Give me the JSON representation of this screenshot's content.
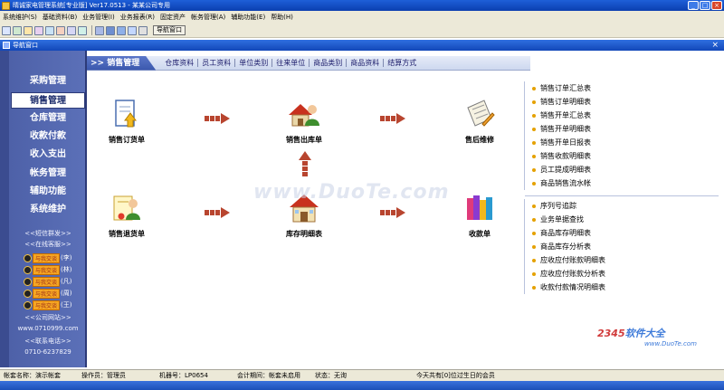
{
  "window": {
    "title": "晴诚家电管理系统[专业版] Ver17.0513 - 某某公司专用"
  },
  "menu": [
    "系统维护(S)",
    "基础资料(B)",
    "业务管理(I)",
    "业务报表(R)",
    "固定资产",
    "帐务管理(A)",
    "辅助功能(E)",
    "帮助(H)"
  ],
  "toolbar": {
    "nav_label": "导航窗口"
  },
  "inner_window": {
    "title": "导航窗口"
  },
  "sidebar": {
    "items": [
      "采购管理",
      "销售管理",
      "仓库管理",
      "收款付款",
      "收入支出",
      "帐务管理",
      "辅助功能",
      "系统维护"
    ],
    "active": "销售管理",
    "sms": "<<短信群发>>",
    "online": "<<在线客服>>",
    "qq": [
      {
        "badge": "与我交谈",
        "name": "(李)"
      },
      {
        "badge": "与我交谈",
        "name": "(林)"
      },
      {
        "badge": "与我交谈",
        "name": "(凡)"
      },
      {
        "badge": "与我交谈",
        "name": "(周)"
      },
      {
        "badge": "与我交谈",
        "name": "(王)"
      }
    ],
    "site_label": "<<公司网站>>",
    "site": "www.0710999.com",
    "phone_label": "<<联系电话>>",
    "phone": "0710-6237829"
  },
  "tabs": {
    "active": ">> 销售管理",
    "items": [
      "仓库资料",
      "员工资料",
      "单位类别",
      "往来单位",
      "商品类别",
      "商品资料",
      "结算方式"
    ]
  },
  "flow": {
    "order": "销售订货单",
    "outbound": "销售出库单",
    "service": "售后维修",
    "return": "销售退货单",
    "inventory": "库存明细表",
    "receipt": "收款单"
  },
  "reports_top": [
    "销售订单汇总表",
    "销售订单明细表",
    "销售开单汇总表",
    "销售开单明细表",
    "销售开单日报表",
    "销售收款明细表",
    "员工提成明细表",
    "商品销售流水帐"
  ],
  "reports_bottom": [
    "序列号追踪",
    "业务单据查找",
    "商品库存明细表",
    "商品库存分析表",
    "应收应付账款明细表",
    "应收应付账款分析表",
    "收款付款情况明细表"
  ],
  "watermark": {
    "main": "www.DuoTe.com",
    "brand_a": "2345",
    "brand_b": "软件大全",
    "url": "www.DuoTe.com"
  },
  "status": {
    "account": "帐套名称：演示帐套",
    "operator": "操作员：管理员",
    "machine": "机器号：LP0654",
    "period": "会计期间：帐套未启用",
    "state": "状态：无询",
    "birthday": "今天共有[0]位过生日的会员"
  }
}
